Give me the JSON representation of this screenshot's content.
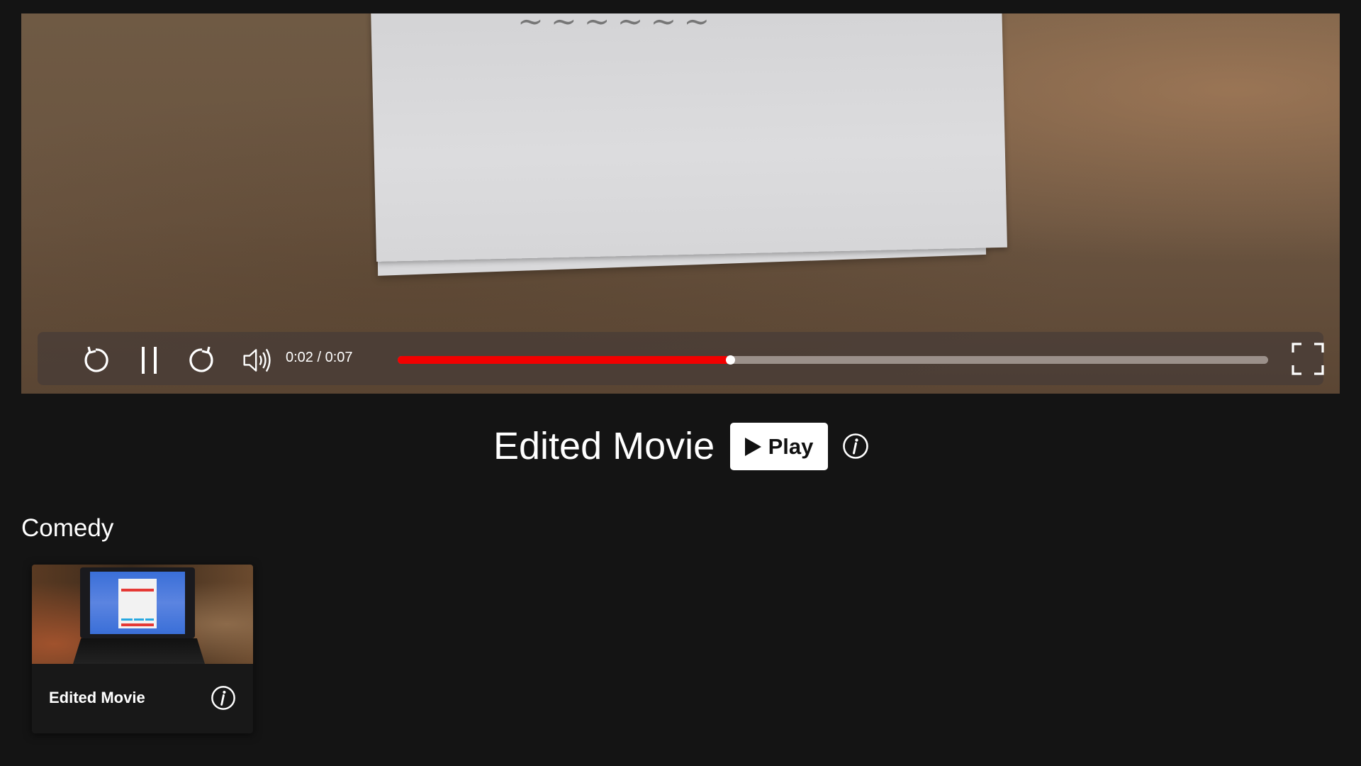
{
  "player": {
    "time_display": "0:02 / 0:07",
    "progress_fraction": 0.382,
    "colors": {
      "progress_fill": "#f20000",
      "progress_track": "#9b908a",
      "thumb": "#ffffff"
    },
    "icons": {
      "rewind": "rewind-icon",
      "pause": "pause-icon",
      "forward": "forward-icon",
      "volume": "volume-icon",
      "fullscreen": "fullscreen-icon"
    }
  },
  "featured": {
    "title": "Edited Movie",
    "play_label": "Play",
    "info_icon": "info-icon"
  },
  "rows": [
    {
      "title": "Comedy",
      "items": [
        {
          "title": "Edited Movie",
          "info_icon": "info-icon"
        }
      ]
    }
  ],
  "colors": {
    "background": "#141414",
    "card_background": "#181818",
    "play_button_bg": "#ffffff",
    "text": "#ffffff"
  }
}
